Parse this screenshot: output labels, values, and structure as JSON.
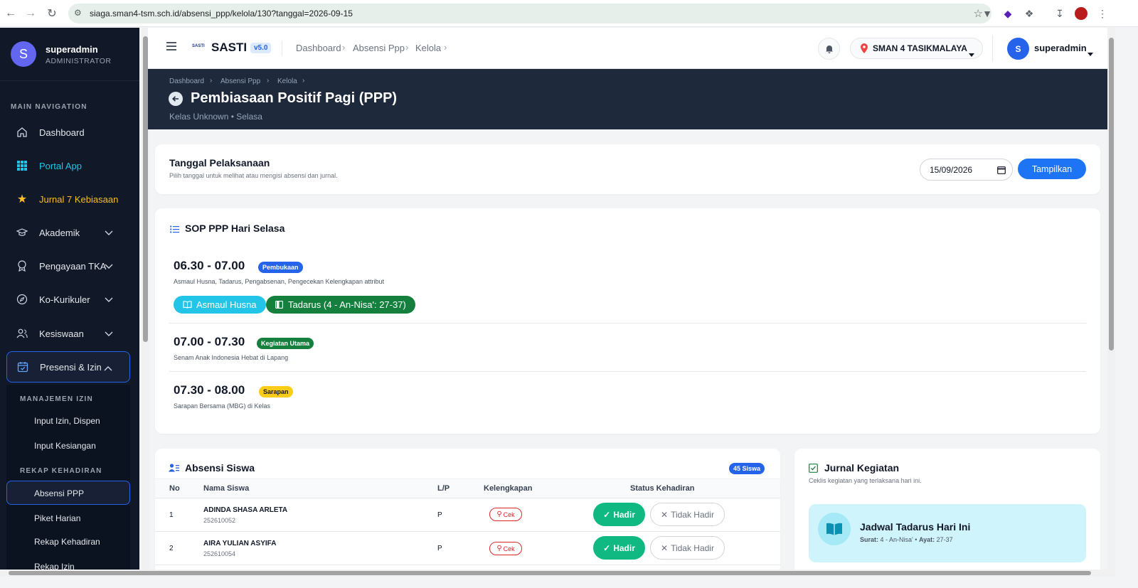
{
  "browser": {
    "url": "siaga.sman4-tsm.sch.id/absensi_ppp/kelola/130?tanggal=2026-09-15"
  },
  "user": {
    "initial": "S",
    "name": "superadmin",
    "role": "ADMINISTRATOR"
  },
  "sidebar": {
    "section_main": "MAIN NAVIGATION",
    "items": [
      {
        "label": "Dashboard",
        "icon": "home-icon"
      },
      {
        "label": "Portal App",
        "icon": "grid-icon"
      },
      {
        "label": "Jurnal 7 Kebiasaan",
        "icon": "star-icon"
      },
      {
        "label": "Akademik",
        "icon": "graduation-cap-icon"
      },
      {
        "label": "Pengayaan TKA",
        "icon": "award-icon"
      },
      {
        "label": "Ko-Kurikuler",
        "icon": "compass-icon"
      },
      {
        "label": "Kesiswaan",
        "icon": "users-icon"
      },
      {
        "label": "Presensi & Izin",
        "icon": "calendar-check-icon"
      }
    ],
    "section_izin": "MANAJEMEN IZIN",
    "izin_items": [
      "Input Izin, Dispen",
      "Input Kesiangan"
    ],
    "section_rekap": "REKAP KEHADIRAN",
    "rekap_items": [
      "Absensi PPP",
      "Piket Harian",
      "Rekap Kehadiran",
      "Rekap Izin"
    ]
  },
  "topbar": {
    "app_logo_text": "SASTI",
    "app_name": "SASTI",
    "version": "v5.0",
    "breadcrumbs": [
      "Dashboard",
      "Absensi Ppp",
      "Kelola"
    ],
    "school": "SMAN 4 TASIKMALAYA",
    "user_initial": "S",
    "user_name": "superadmin"
  },
  "hero": {
    "breadcrumbs": [
      "Dashboard",
      "Absensi Ppp",
      "Kelola"
    ],
    "title": "Pembiasaan Positif Pagi (PPP)",
    "subtitle": "Kelas Unknown • Selasa"
  },
  "date_card": {
    "title": "Tanggal Pelaksanaan",
    "hint": "Pilih tanggal untuk melihat atau mengisi absensi dan jurnal.",
    "date_value": "15/09/2026",
    "button": "Tampilkan"
  },
  "sop": {
    "title": "SOP PPP Hari Selasa",
    "sessions": [
      {
        "time": "06.30 - 07.00",
        "badge": "Pembukaan",
        "badge_color": "#2563eb",
        "desc": "Asmaul Husna, Tadarus, Pengabsenan, Pengecekan Kelengkapan attribut"
      },
      {
        "time": "07.00 - 07.30",
        "badge": "Kegiatan Utama",
        "badge_color": "#15803d",
        "desc": "Senam Anak Indonesia Hebat di Lapang"
      },
      {
        "time": "07.30 - 08.00",
        "badge": "Sarapan",
        "badge_color": "#facc15",
        "desc": "Sarapan Bersama (MBG) di Kelas"
      }
    ],
    "buttons": [
      "Asmaul Husna",
      "Tadarus (4 - An-Nisa': 27-37)"
    ]
  },
  "absensi": {
    "title": "Absensi Siswa",
    "count_badge": "45 Siswa",
    "columns": [
      "No",
      "Nama Siswa",
      "L/P",
      "Kelengkapan",
      "Status Kehadiran"
    ],
    "rows": [
      {
        "no": "1",
        "name": "ADINDA SHASA ARLETA",
        "nis": "252610052",
        "gender": "P",
        "cek": "Cek",
        "hadir": "Hadir",
        "tidak": "Tidak Hadir"
      },
      {
        "no": "2",
        "name": "AIRA YULIAN ASYIFA",
        "nis": "252610054",
        "gender": "P",
        "cek": "Cek",
        "hadir": "Hadir",
        "tidak": "Tidak Hadir"
      }
    ]
  },
  "jurnal": {
    "title": "Jurnal Kegiatan",
    "hint": "Ceklis kegiatan yang terlaksana hari ini.",
    "tadarus_title": "Jadwal Tadarus Hari Ini",
    "surat_label": "Surat:",
    "surat_value": "4 - An-Nisa'",
    "ayat_label": "Ayat:",
    "ayat_value": "27-37"
  },
  "colors": {
    "primary": "#2563eb",
    "sidebar_bg": "#111827",
    "hero_bg": "#1e293b",
    "accent_cyan": "#22c5e8",
    "accent_green": "#15803d",
    "hadir_green": "#10b981",
    "star_yellow": "#fbbf24"
  }
}
